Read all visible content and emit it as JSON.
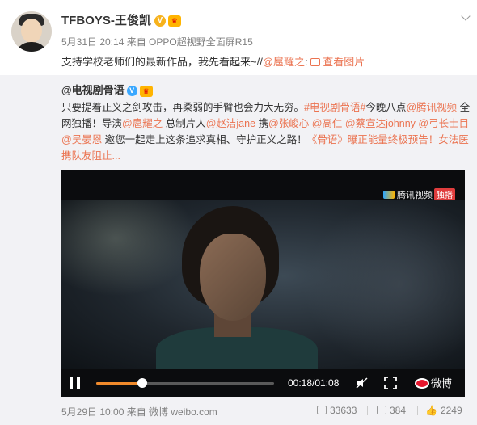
{
  "post": {
    "author": "TFBOYS-王俊凯",
    "meta": "5月31日 20:14 来自 OPPO超视野全面屏R15",
    "text_prefix": "支持学校老师们的最新作品，我先看起来~//",
    "text_mention": "@扈耀之",
    "text_colon": ":",
    "view_pic": "查看图片"
  },
  "repost": {
    "author": "@电视剧骨语",
    "text_a": "只要提着正义之剑攻击，再柔弱的手臂也会力大无穷。",
    "tag1": "#电视剧骨语#",
    "text_b": "今晚八点",
    "link1": "@腾讯视频",
    "text_c": " 全网独播！导演",
    "link2": "@扈耀之",
    "text_d": " 总制片人",
    "link3": "@赵洁jane",
    "text_e": " 携",
    "link4": "@张峻心",
    "link5": "@高仁",
    "link6": "@蔡宣达johnny",
    "link7": "@弓长士目",
    "link8": "@吴晏恩",
    "text_f": " 邀您一起走上这条追求真相、守护正义之路！",
    "link9": "《骨语》曝正能量终极预告！女法医携队友阻止...",
    "meta": "5月29日 10:00 来自 微博 weibo.com",
    "stats": {
      "reposts": "33633",
      "comments": "384",
      "likes": "2249"
    }
  },
  "video": {
    "watermark": "腾讯视频",
    "watermark_tag": "独播",
    "time": "00:18/01:08",
    "progress": 0.26,
    "brand": "微博"
  },
  "icons": [
    "verified-v-icon",
    "crown-icon",
    "picture-icon",
    "chevron-down-icon",
    "pause-icon",
    "mute-icon",
    "fullscreen-icon",
    "weibo-logo-icon",
    "repost-icon",
    "comment-icon",
    "like-icon"
  ]
}
